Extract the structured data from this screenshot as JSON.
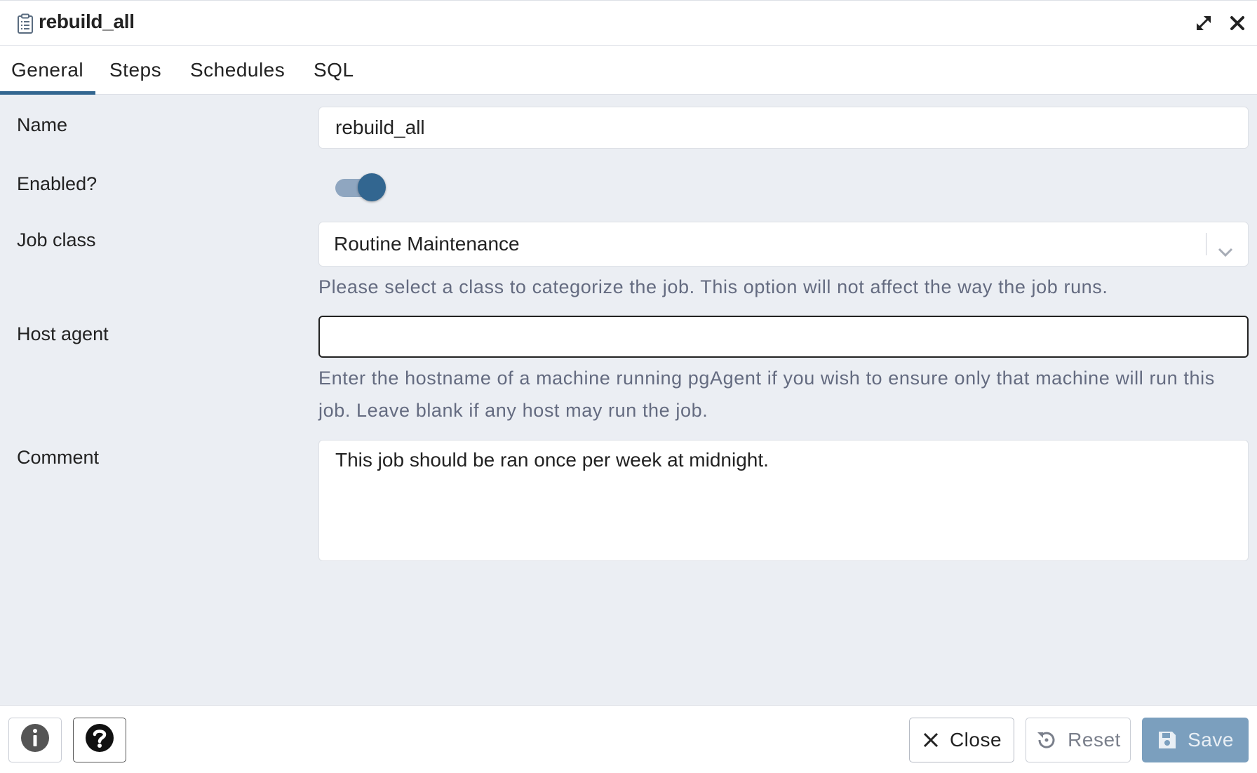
{
  "dialog": {
    "title": "rebuild_all",
    "title_icon": "clipboard-icon",
    "expand_icon": "expand-icon",
    "close_icon": "close-icon"
  },
  "tabs": [
    {
      "label": "General",
      "active": true
    },
    {
      "label": "Steps",
      "active": false
    },
    {
      "label": "Schedules",
      "active": false
    },
    {
      "label": "SQL",
      "active": false
    }
  ],
  "form": {
    "name": {
      "label": "Name",
      "value": "rebuild_all"
    },
    "enabled": {
      "label": "Enabled?",
      "checked": true
    },
    "job_class": {
      "label": "Job class",
      "value": "Routine Maintenance",
      "help": "Please select a class to categorize the job. This option will not affect the way the job runs."
    },
    "host_agent": {
      "label": "Host agent",
      "value": "",
      "help": "Enter the hostname of a machine running pgAgent if you wish to ensure only that machine will run this job. Leave blank if any host may run the job."
    },
    "comment": {
      "label": "Comment",
      "value": "This job should be ran once per week at midnight."
    }
  },
  "footer": {
    "info_icon": "info-icon",
    "help_icon": "help-icon",
    "close_label": "Close",
    "reset_label": "Reset",
    "save_label": "Save"
  },
  "colors": {
    "accent": "#326690",
    "form_background": "#ebeef3",
    "help_text": "#646b80",
    "save_button": "#7b9fbe"
  }
}
